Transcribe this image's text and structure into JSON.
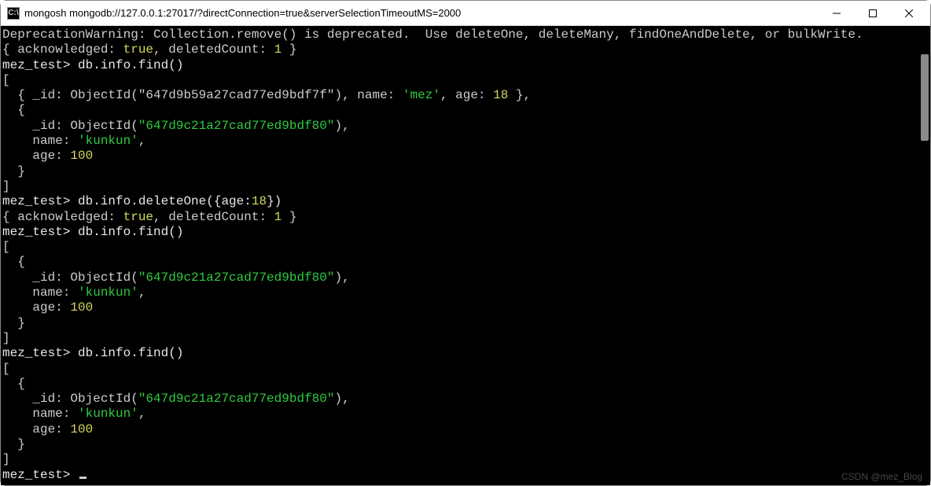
{
  "window": {
    "app_icon_label": "C:\\",
    "title": "mongosh mongodb://127.0.0.1:27017/?directConnection=true&serverSelectionTimeoutMS=2000"
  },
  "terminal": {
    "deprecation": "DeprecationWarning: Collection.remove() is deprecated.  Use deleteOne, deleteMany, findOneAndDelete, or bulkWrite.",
    "ack_line1_prefix": "{ acknowledged: ",
    "ack_true": "true",
    "ack_mid": ", deletedCount: ",
    "ack_count": "1",
    "ack_suffix": " }",
    "prompt": "mez_test>",
    "cmd_find": " db.info.find()",
    "cmd_deleteOne_prefix": " db.info.deleteOne({age:",
    "cmd_deleteOne_age": "18",
    "cmd_deleteOne_suffix": "})",
    "open_arr": "[",
    "close_arr": "]",
    "doc1_line": "  { _id: ObjectId(\"647d9b59a27cad77ed9bdf7f\"), name: ",
    "doc1_name": "'mez'",
    "doc1_mid": ", age: ",
    "doc1_age": "18",
    "doc1_end": " },",
    "open_obj": "  {",
    "close_obj": "  }",
    "id_line_prefix": "    _id: ObjectId(",
    "id_647d9c21": "\"647d9c21a27cad77ed9bdf80\"",
    "id_line_suffix": "),",
    "name_line_prefix": "    name: ",
    "kunkun": "'kunkun'",
    "comma": ",",
    "age_line_prefix": "    age: ",
    "age_100": "100"
  },
  "watermark": "CSDN @mez_Blog"
}
